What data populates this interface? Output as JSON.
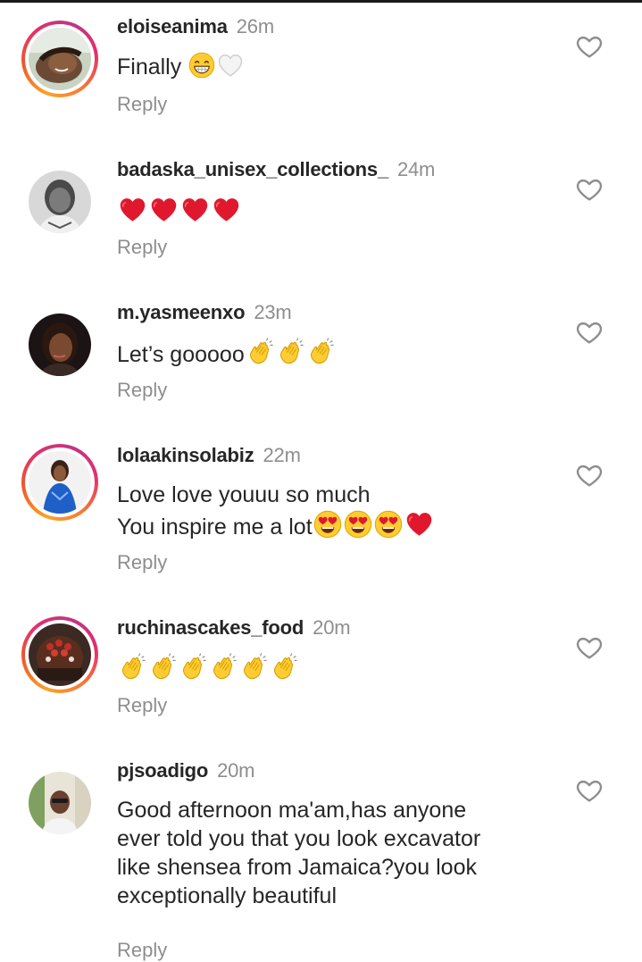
{
  "comments": [
    {
      "username": "eloiseanima",
      "time": "26m",
      "text": "Finally",
      "reply": "Reply",
      "emojis": [
        "grin-emoji",
        "white-heart-emoji"
      ]
    },
    {
      "username": "badaska_unisex_collections_",
      "time": "24m",
      "text": "",
      "reply": "Reply",
      "emojis": [
        "red-heart-emoji",
        "red-heart-emoji",
        "red-heart-emoji",
        "red-heart-emoji"
      ]
    },
    {
      "username": "m.yasmeenxo",
      "time": "23m",
      "text": "Let’s gooooo",
      "reply": "Reply",
      "emojis": [
        "clap-emoji",
        "clap-emoji",
        "clap-emoji"
      ]
    },
    {
      "username": "lolaakinsolabiz",
      "time": "22m",
      "text_line1": "Love love youuu so much",
      "text_line2": "You inspire me a lot",
      "reply": "Reply",
      "emojis": [
        "heart-eyes-emoji",
        "heart-eyes-emoji",
        "heart-eyes-emoji",
        "red-heart-emoji"
      ]
    },
    {
      "username": "ruchinascakes_food",
      "time": "20m",
      "text": "",
      "reply": "Reply",
      "emojis": [
        "clap-emoji",
        "clap-emoji",
        "clap-emoji",
        "clap-emoji",
        "clap-emoji",
        "clap-emoji"
      ]
    },
    {
      "username": "pjsoadigo",
      "time": "20m",
      "text_lines": [
        "Good afternoon ma'am,has anyone",
        "ever told you that you look excavator",
        "like shensea from Jamaica?you look",
        "exceptionally beautiful"
      ],
      "reply": "Reply",
      "emojis": []
    }
  ],
  "icons": {
    "like": "heart-outline-icon",
    "story_ring": "story-ring-gradient"
  },
  "colors": {
    "text": "#262626",
    "muted": "#8e8e8e",
    "heart_red": "#e0182d",
    "emoji_yellow": "#ffcc33"
  }
}
